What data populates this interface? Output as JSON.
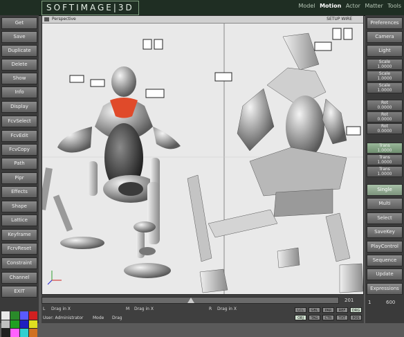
{
  "app": {
    "logo": "SOFTIMAGE|3D"
  },
  "modules": [
    "Model",
    "Motion",
    "Actor",
    "Matter",
    "Tools"
  ],
  "active_module": "Motion",
  "left_menu": [
    "Get",
    "Save",
    "Duplicate",
    "Delete",
    "Show",
    "Info",
    "Display",
    "FcvSelect",
    "FcvEdit",
    "FcvCopy",
    "Path",
    "Pipr",
    "Effects",
    "Shape",
    "Lattice",
    "Keyframe",
    "FcrvReset",
    "Constraint",
    "Channel",
    "EXIT"
  ],
  "right_menu": {
    "top": [
      "Preferences",
      "Camera",
      "Light"
    ],
    "fields": [
      {
        "label": "Scale",
        "value": "1.0000"
      },
      {
        "label": "Scale",
        "value": "1.0000"
      },
      {
        "label": "Scale",
        "value": "1.0000"
      },
      {
        "label": "Rot",
        "value": "0.0000"
      },
      {
        "label": "Rot",
        "value": "0.0000"
      },
      {
        "label": "Rot",
        "value": "0.0000"
      },
      {
        "label": "Trans",
        "value": "1.0000"
      },
      {
        "label": "Trans",
        "value": "1.0000"
      },
      {
        "label": "Trans",
        "value": "1.0000"
      }
    ],
    "bottom": [
      "Single",
      "Multi",
      "Select",
      "SaveKey",
      "PlayControl",
      "Sequence",
      "Update",
      "Expressions"
    ]
  },
  "viewport": {
    "title": "Perspective",
    "menu": "SETUP  WIRE"
  },
  "timeline": {
    "frame": "201",
    "range_start": "1",
    "range_end": "600"
  },
  "mouse_hint": {
    "left": "L",
    "left_action": "Drag in X",
    "middle": "M",
    "middle_action": "Drag in X",
    "right": "R",
    "right_action": "Drag in X"
  },
  "status": {
    "user": "User: Administrator",
    "mode_label": "Mode",
    "mode_value": "Drag"
  },
  "tags_row1": [
    "LCL",
    "GBL",
    "PAR",
    "REF",
    "DRG"
  ],
  "tags_row2": [
    "OBJ",
    "TAG",
    "CTR",
    "TXT",
    "POS"
  ],
  "palette_colors": [
    "#e8e8e8",
    "#2a8a2a",
    "#5a5aff",
    "#d02020",
    "#c0c0c0",
    "#20a020",
    "#2020c0",
    "#e0e020",
    "#202020",
    "#ff60ff",
    "#30d0d0",
    "#d07020"
  ]
}
